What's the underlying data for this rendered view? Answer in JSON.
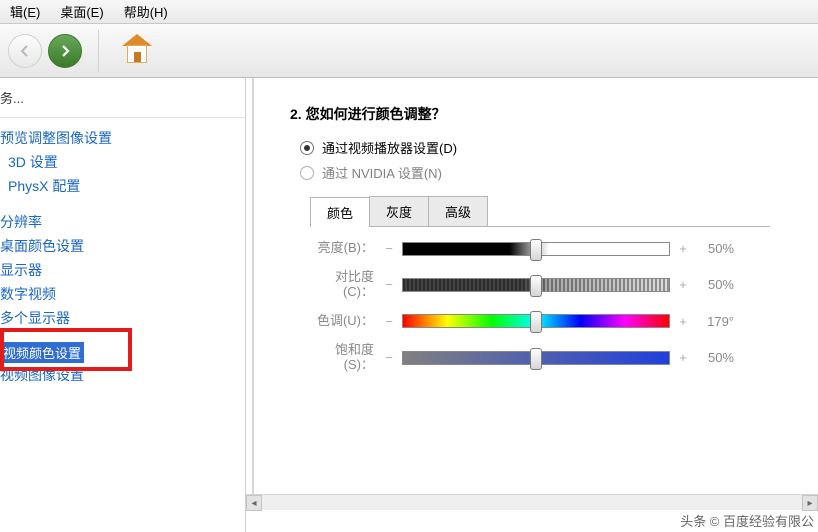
{
  "menu": {
    "edit": "辑(E)",
    "desktop": "桌面(E)",
    "help": "帮助(H)"
  },
  "nav": {
    "title": "务...",
    "items_top": [
      "预览调整图像设置",
      "3D 设置",
      "PhysX 配置"
    ],
    "items_mid": [
      "分辨率",
      "桌面颜色设置",
      "显示器",
      "数字视频",
      "多个显示器"
    ],
    "selected": "视频颜色设置",
    "below_sel": "视频图像设置"
  },
  "main": {
    "question": "2. 您如何进行颜色调整？",
    "opt1": "通过视频播放器设置(D)",
    "opt2": "通过 NVIDIA 设置(N)",
    "tabs": {
      "color": "颜色",
      "gray": "灰度",
      "adv": "高级"
    },
    "sliders": {
      "brightness": {
        "label": "亮度(B)：",
        "value": "50%",
        "pos": 50
      },
      "contrast": {
        "label": "对比度(C)：",
        "value": "50%",
        "pos": 50
      },
      "hue": {
        "label": "色调(U)：",
        "value": "179°",
        "pos": 50
      },
      "saturation": {
        "label": "饱和度(S)：",
        "value": "50%",
        "pos": 50
      }
    }
  },
  "watermark": "头条 © 百度经验有限公"
}
